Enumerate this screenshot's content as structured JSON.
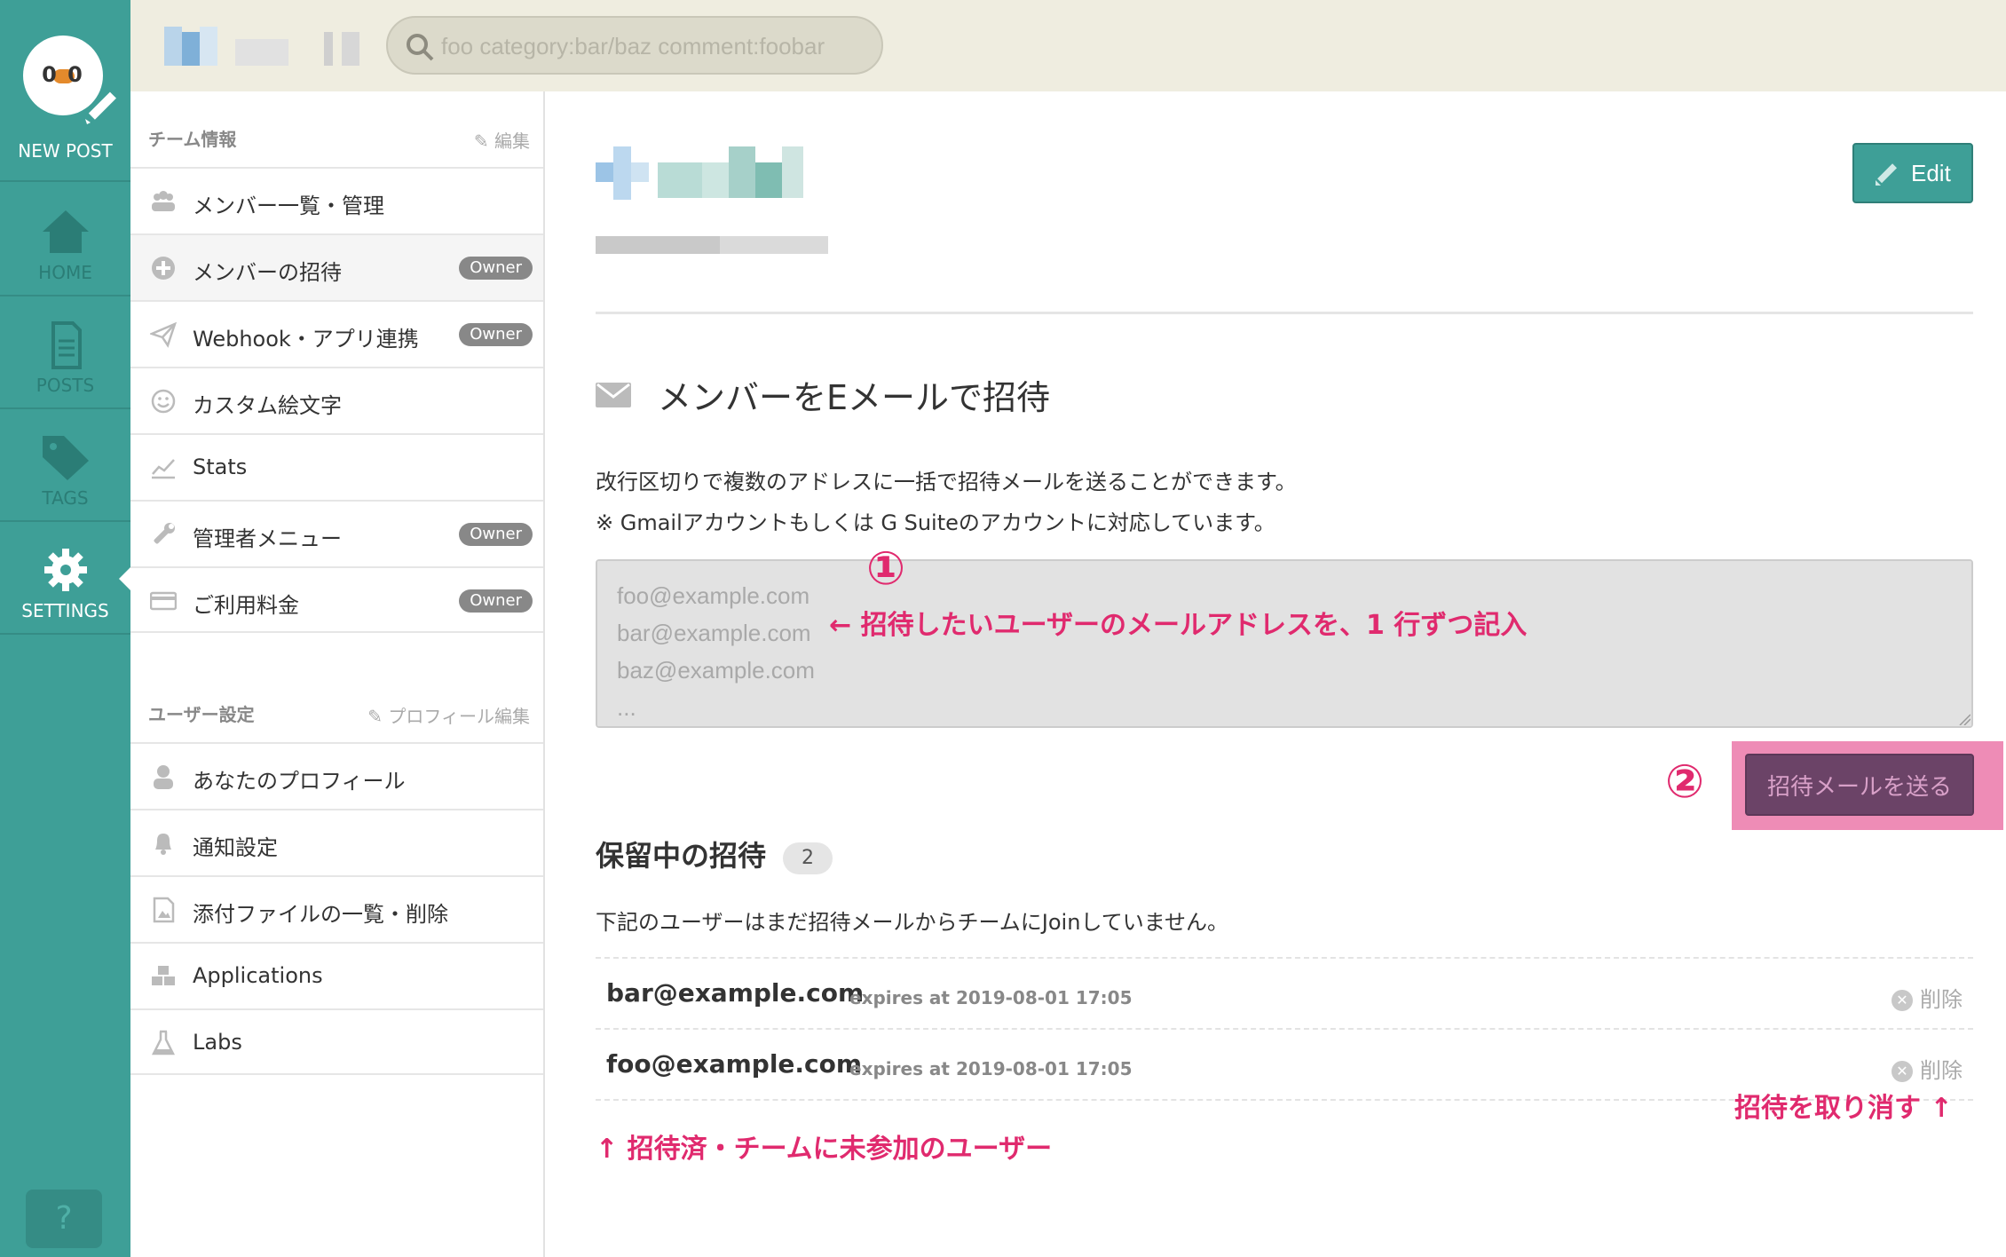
{
  "nav": {
    "new_post": "NEW POST",
    "logo": "0 0",
    "items": [
      {
        "label": "HOME",
        "icon": "home-icon"
      },
      {
        "label": "POSTS",
        "icon": "posts-icon"
      },
      {
        "label": "TAGS",
        "icon": "tags-icon"
      },
      {
        "label": "SETTINGS",
        "icon": "gear-icon"
      }
    ],
    "help": "?"
  },
  "topbar": {
    "search_placeholder": "foo category:bar/baz comment:foobar"
  },
  "sidebar": {
    "team_section": {
      "title": "チーム情報",
      "action": "✎ 編集"
    },
    "team_items": [
      {
        "label": "メンバー一覧・管理",
        "badge": ""
      },
      {
        "label": "メンバーの招待",
        "badge": "Owner"
      },
      {
        "label": "Webhook・アプリ連携",
        "badge": "Owner"
      },
      {
        "label": "カスタム絵文字",
        "badge": ""
      },
      {
        "label": "Stats",
        "badge": ""
      },
      {
        "label": "管理者メニュー",
        "badge": "Owner"
      },
      {
        "label": "ご利用料金",
        "badge": "Owner"
      }
    ],
    "user_section": {
      "title": "ユーザー設定",
      "action": "✎ プロフィール編集"
    },
    "user_items": [
      {
        "label": "あなたのプロフィール"
      },
      {
        "label": "通知設定"
      },
      {
        "label": "添付ファイルの一覧・削除"
      },
      {
        "label": "Applications"
      },
      {
        "label": "Labs"
      }
    ]
  },
  "main": {
    "edit_label": "Edit",
    "invite_title": "メンバーをEメールで招待",
    "desc1": "改行区切りで複数のアドレスに一括で招待メールを送ることができます。",
    "desc2": "※ Gmailアカウントもしくは G Suiteのアカウントに対応しています。",
    "emails_placeholder": "foo@example.com\nbar@example.com\nbaz@example.com\n...",
    "send_label": "招待メールを送る",
    "pending_title": "保留中の招待",
    "pending_count": "2",
    "pending_desc": "下記のユーザーはまだ招待メールからチームにJoinしていません。",
    "invites": [
      {
        "email": "bar@example.com",
        "expires": "expires at 2019-08-01 17:05",
        "delete": "削除"
      },
      {
        "email": "foo@example.com",
        "expires": "expires at 2019-08-01 17:05",
        "delete": "削除"
      }
    ]
  },
  "annotations": {
    "num1": "①",
    "text1": "← 招待したいユーザーのメールアドレスを、1 行ずつ記入",
    "num2": "②",
    "text3": "↑ 招待済・チームに未参加のユーザー",
    "text4": "招待を取り消す ↑"
  },
  "colors": {
    "nav_bg": "#3e9f97",
    "topbar_bg": "#efede0",
    "annotation": "#e02a6e",
    "send_button": "#6b4367"
  }
}
